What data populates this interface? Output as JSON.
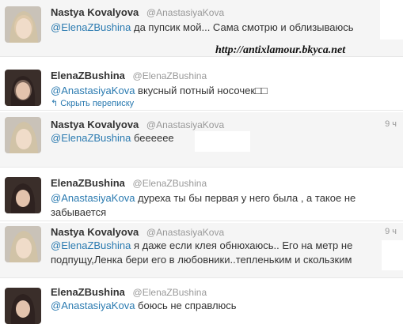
{
  "watermark": "http://antixlamour.bkyca.net",
  "tweets": [
    {
      "name": "Nastya Kovalyova",
      "handle": "@AnastasiyaKova",
      "time": "",
      "mention": "@ElenaZBushina",
      "text": " да пупсик мой... Сама смотрю и облизываюсь",
      "text2": ""
    },
    {
      "name": "ElenaZBushina",
      "handle": "@ElenaZBushina",
      "time": "",
      "mention": "@AnastasiyaKova",
      "text": " вкусный потный носочек□□",
      "text2": "",
      "link": "Скрыть переписку"
    },
    {
      "name": "Nastya Kovalyova",
      "handle": "@AnastasiyaKova",
      "time": "9 ч",
      "mention": "@ElenaZBushina",
      "text": " беееееe",
      "text2": ""
    },
    {
      "name": "ElenaZBushina",
      "handle": "@ElenaZBushina",
      "time": "",
      "mention": "@AnastasiyaKova",
      "text": " дуреха ты бы первая у него была , а такое не",
      "text2": "забывается"
    },
    {
      "name": "Nastya Kovalyova",
      "handle": "@AnastasiyaKova",
      "time": "9 ч",
      "mention": "@ElenaZBushina",
      "text": " я даже если клея обнюхаюсь.. Его на метр не",
      "text2": "подпущу,Ленка бери его в любовники..тепленьким и скользким"
    },
    {
      "name": "ElenaZBushina",
      "handle": "@ElenaZBushina",
      "time": "",
      "mention": "@AnastasiyaKova",
      "text": " боюсь не справлюсь",
      "text2": ""
    }
  ]
}
